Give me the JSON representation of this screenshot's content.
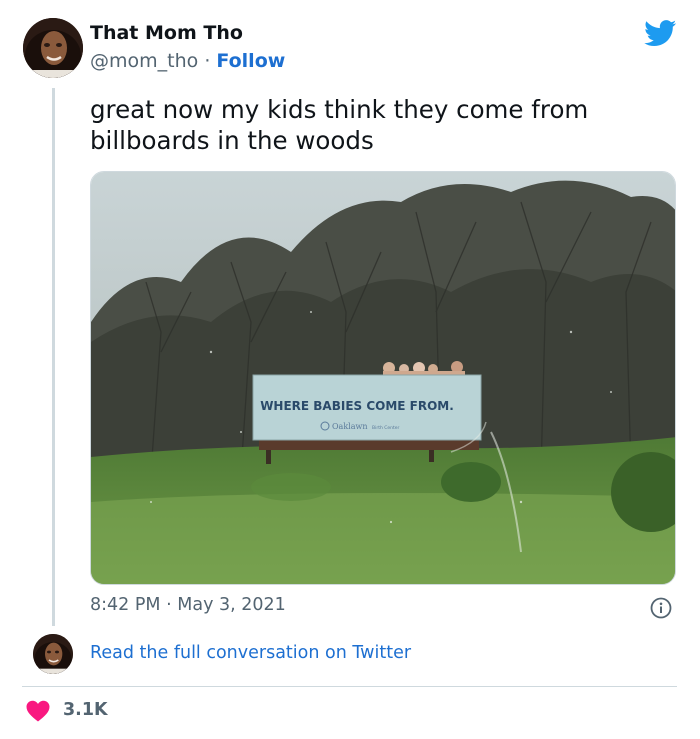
{
  "author": {
    "name": "That Mom Tho",
    "handle": "@mom_tho",
    "separator": "·",
    "follow_label": "Follow"
  },
  "tweet": {
    "text": "great now my kids think they come from billboards in the woods",
    "time": "8:42 PM",
    "date_separator": "·",
    "date": "May 3, 2021"
  },
  "photo": {
    "billboard_headline": "WHERE BABIES COME FROM.",
    "billboard_brand": "Oaklawn",
    "billboard_tagline": "Birth Center"
  },
  "footer": {
    "read_more_label": "Read the full conversation on Twitter",
    "likes": "3.1K"
  },
  "colors": {
    "accent_blue": "#1d6fd1",
    "twitter_blue": "#1d9bf0",
    "like_pink": "#f91880",
    "muted_text": "#536471"
  },
  "icons": {
    "logo": "twitter-bird-icon",
    "info": "info-icon",
    "like": "heart-icon"
  }
}
